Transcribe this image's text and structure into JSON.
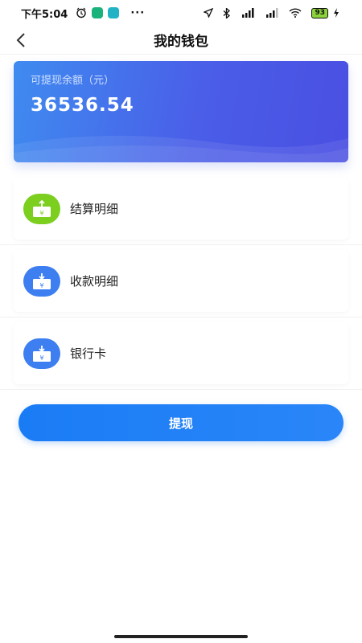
{
  "status_bar": {
    "time": "下午5:04",
    "battery": "93",
    "icons": [
      "alarm-icon",
      "app-badge-green-icon",
      "app-badge-teal-icon",
      "more-dots-icon",
      "location-icon",
      "bluetooth-icon",
      "signal-hd-icon",
      "signal-hd-icon",
      "wifi-icon",
      "battery-icon",
      "charging-icon"
    ]
  },
  "nav": {
    "title": "我的钱包",
    "back_icon": "chevron-left-icon"
  },
  "balance": {
    "label": "可提现余额（元）",
    "value": "36536.54"
  },
  "menu": [
    {
      "label": "结算明细",
      "icon": "settlement-icon",
      "icon_color": "#7ccf1f"
    },
    {
      "label": "收款明细",
      "icon": "receipt-icon",
      "icon_color": "#3d7ff0"
    },
    {
      "label": "银行卡",
      "icon": "bank-card-icon",
      "icon_color": "#3d7ff0"
    }
  ],
  "withdraw_button": {
    "label": "提现"
  },
  "colors": {
    "primary": "#1a7cf5",
    "card_start": "#3f8bf0",
    "card_end": "#4a4fe2",
    "green": "#7ccf1f"
  }
}
